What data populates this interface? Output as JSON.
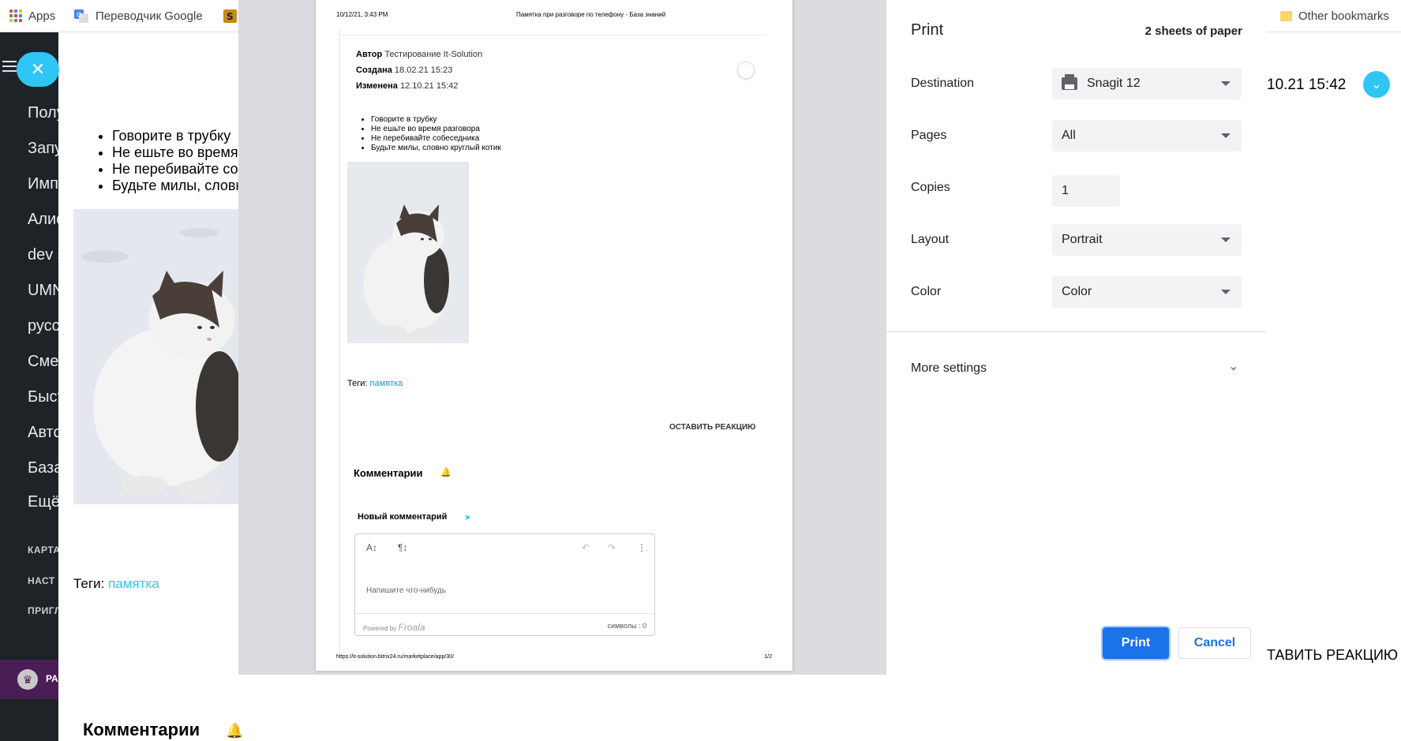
{
  "bookmarks": {
    "apps": "Apps",
    "translator": "Переводчик Google",
    "other": "Other bookmarks"
  },
  "sidebar": {
    "items": [
      "Полу",
      "Запу",
      "Имп",
      "Алис",
      "dev s",
      "UMN",
      "русс",
      "Сме",
      "Быст",
      "Авто",
      "База",
      "Ещё"
    ],
    "small": [
      "КАРТА",
      "НАСТ",
      "ПРИГЛ"
    ],
    "promo": "РА"
  },
  "background": {
    "list": [
      "Говорите в трубку",
      "Не ешьте во время",
      "Не перебивайте со",
      "Будьте милы, словн"
    ],
    "tags_label": "Теги:",
    "tag": "памятка",
    "date": "10.21 15:42",
    "reaction": "ТАВИТЬ РЕАКЦИЮ",
    "comments": "Комментарии"
  },
  "preview": {
    "header_date": "10/12/21, 3:43 PM",
    "header_title": "Памятка при разговоре по телефону - База знаний",
    "author_label": "Автор",
    "author": "Тестирование It-Solution",
    "created_label": "Создана",
    "created": "18.02.21 15:23",
    "changed_label": "Изменена",
    "changed": "12.10.21 15:42",
    "list": [
      "Говорите в трубку",
      "Не ешьте во время разговора",
      "Не перебивайте собеседника",
      "Будьте милы, словно круглый котик"
    ],
    "tags_label": "Теги:",
    "tag": "памятка",
    "reaction": "ОСТАВИТЬ РЕАКЦИЮ",
    "comments": "Комментарии",
    "new_comment": "Новый комментарий",
    "editor_placeholder": "Напишите что-нибудь",
    "powered": "Powered by",
    "froala": "Froala",
    "chars": "символы : 0",
    "url": "https://it-solution.bitrix24.ru/marketplace/app/30/",
    "page_num": "1/2"
  },
  "print_panel": {
    "title": "Print",
    "sheets": "2 sheets of paper",
    "destination_label": "Destination",
    "destination": "Snagit 12",
    "pages_label": "Pages",
    "pages": "All",
    "copies_label": "Copies",
    "copies": "1",
    "layout_label": "Layout",
    "layout": "Portrait",
    "color_label": "Color",
    "color": "Color",
    "more_settings": "More settings",
    "print_button": "Print",
    "cancel_button": "Cancel"
  },
  "colors": {
    "accent": "#2fc6f6",
    "primary_button": "#1a73e8",
    "sidebar_bg": "#1d2327"
  }
}
